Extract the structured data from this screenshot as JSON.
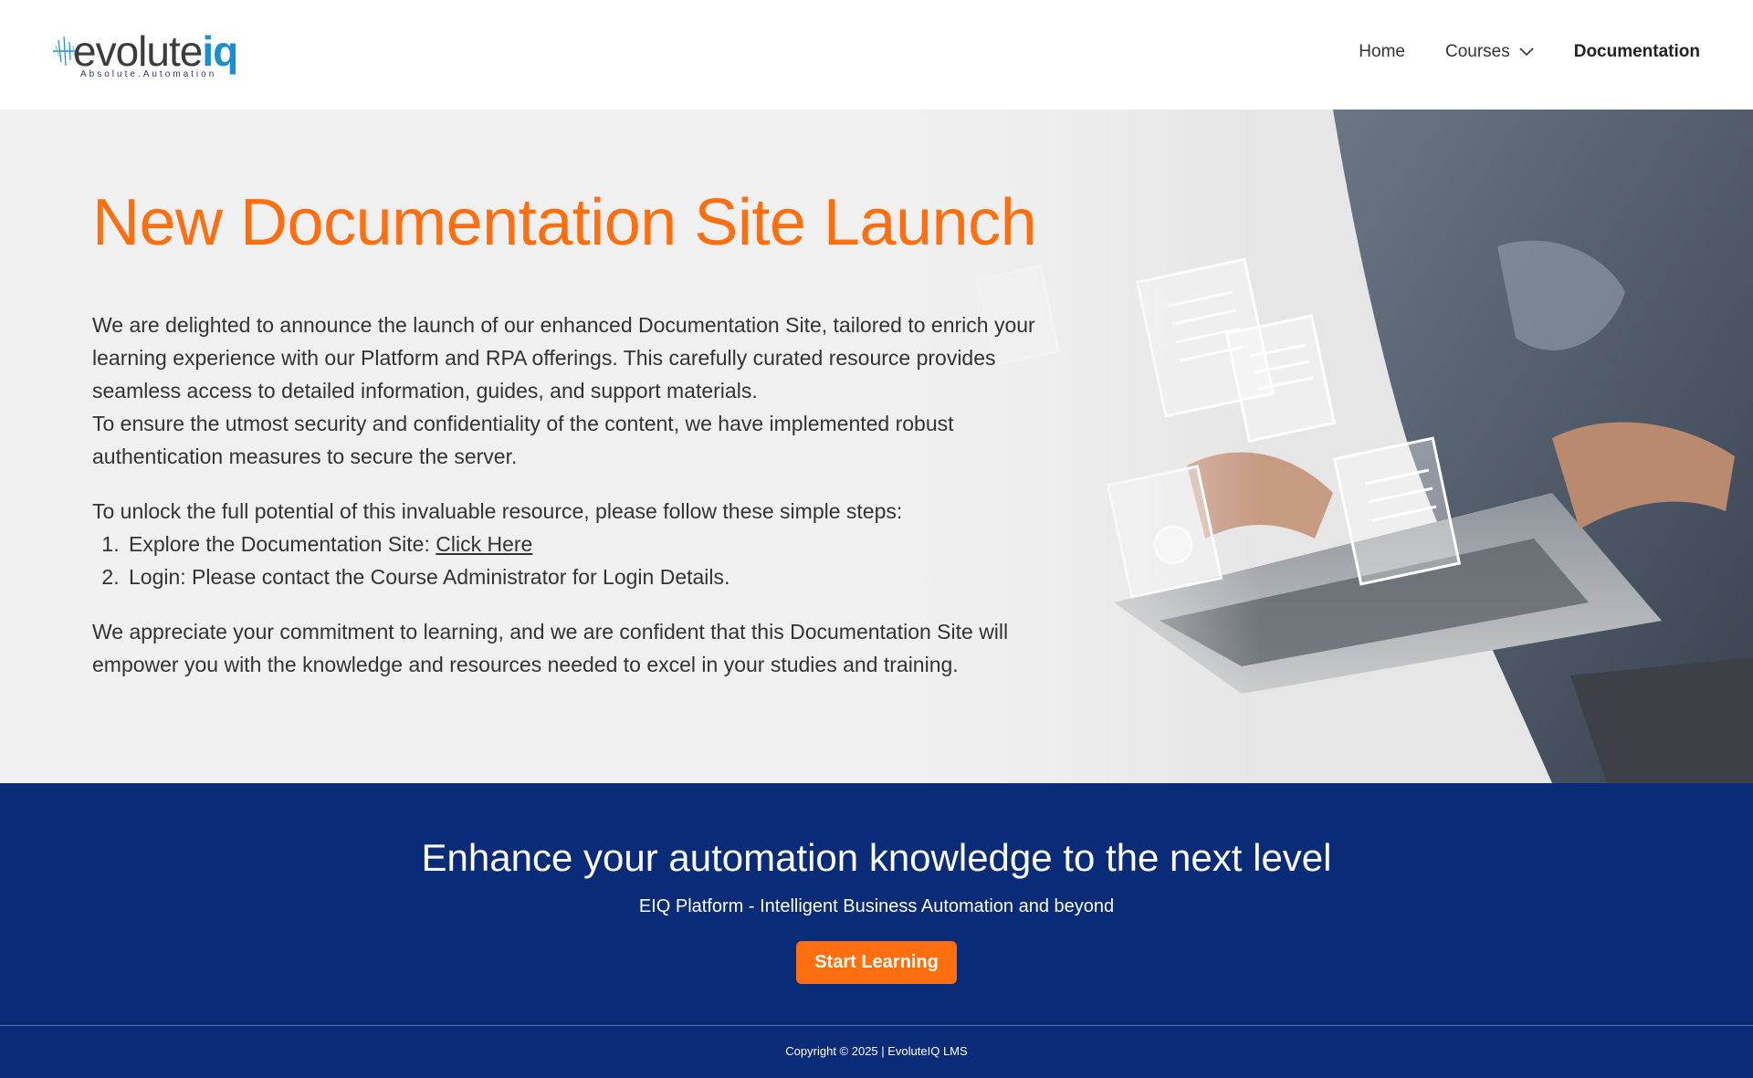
{
  "header": {
    "logo_word": "evolute",
    "logo_word_accent": "iq",
    "logo_tagline": "Absolute.Automation",
    "nav": [
      {
        "label": "Home"
      },
      {
        "label": "Courses"
      },
      {
        "label": "Documentation"
      }
    ]
  },
  "hero": {
    "title": "New Documentation Site Launch",
    "para1_line1": "We are delighted to announce the launch of our enhanced Documentation Site, tailored to enrich your learning experience with our Platform and RPA offerings. This carefully curated resource provides seamless access to detailed information, guides, and support materials.",
    "para1_line2": "To ensure the utmost security and confidentiality of the content, we have implemented robust authentication measures to secure the server.",
    "para2": "To unlock the full potential of this invaluable resource, please follow these simple steps:",
    "steps": [
      {
        "prefix": "Explore the Documentation Site: ",
        "link": "Click Here"
      },
      {
        "text": "Login: Please contact the Course Administrator for Login Details."
      }
    ],
    "para3": "We appreciate your commitment to learning, and we are confident that this Documentation Site will empower you with the knowledge and resources needed to excel in your studies and training."
  },
  "band": {
    "title": "Enhance your automation knowledge to the next level",
    "subtitle": "EIQ Platform - Intelligent Business Automation and beyond",
    "cta_label": "Start Learning"
  },
  "footer": {
    "copyright": "Copyright © 2025 | EvoluteIQ LMS"
  },
  "colors": {
    "accent": "#ff6f0f",
    "band": "#0a2c78",
    "logo_blue": "#1a8fd0"
  }
}
